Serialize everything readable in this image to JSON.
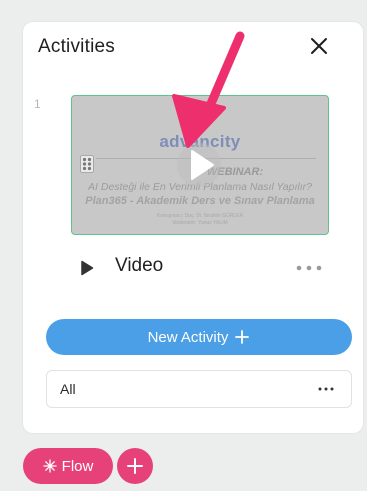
{
  "panel": {
    "title": "Activities",
    "close_icon": "close-icon"
  },
  "activity": {
    "index": "1",
    "thumbnail": {
      "brand": "advancity",
      "heading": "WEBINAR:",
      "line1": "AI Desteği ile En Verimli Planlama Nasıl Yapılır?",
      "line2": "Plan365 - Akademik Ders ve Sınav Planlama",
      "credit1": "Konuşmacı: Doç. Dr. İbrahim GÜRLER",
      "credit2": "Moderatör: Yunus YALIM",
      "play_icon": "play-icon",
      "drag_icon": "drag-handle-icon"
    },
    "type_icon": "play-triangle-icon",
    "label": "Video",
    "more_icon": "more-horizontal-icon"
  },
  "new_activity": {
    "label": "New Activity"
  },
  "filter": {
    "label": "All",
    "more_icon": "more-horizontal-icon"
  },
  "footer": {
    "flow_label": "Flow",
    "add_icon": "plus-icon"
  },
  "colors": {
    "accent_blue": "#4a9fe6",
    "accent_pink": "#e64178",
    "selected_border": "#5fc48a",
    "annotation_arrow": "#ee2f6e"
  }
}
